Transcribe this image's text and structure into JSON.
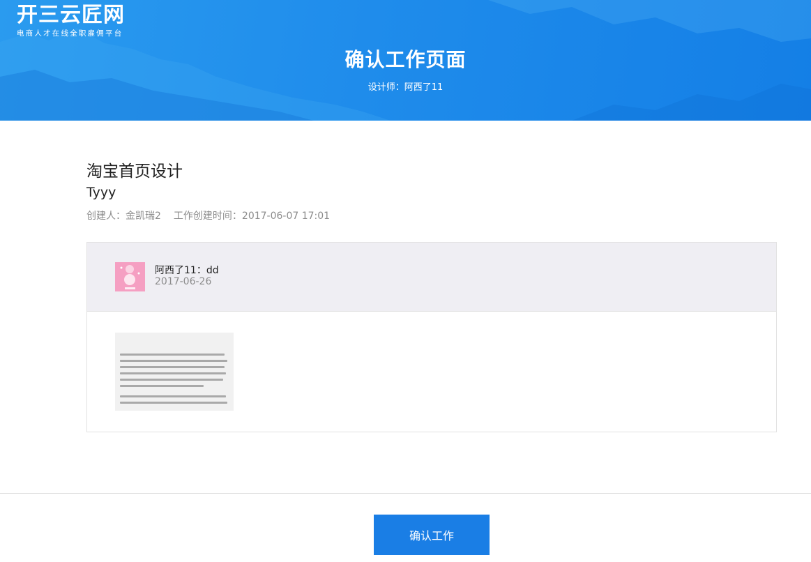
{
  "brand": {
    "name": "开三云匠网",
    "slogan": "电商人才在线全职雇佣平台"
  },
  "header": {
    "title": "确认工作页面",
    "designer": "设计师：阿西了11"
  },
  "job": {
    "title": "淘宝首页设计",
    "description": "Tyyy",
    "creator": "创建人：金凯瑞2",
    "created_time": "工作创建时间：2017-06-07 17:01"
  },
  "submission": {
    "author_line": "阿西了11：dd",
    "date": "2017-06-26",
    "avatar_icon": "avatar-thumbnail-icon",
    "attachment_icon": "attachment-thumbnail-icon"
  },
  "actions": {
    "confirm_label": "确认工作"
  },
  "colors": {
    "header_blue": "#1f8ceb",
    "button_blue": "#1a7ee5",
    "card_header_bg": "#efeef3"
  }
}
